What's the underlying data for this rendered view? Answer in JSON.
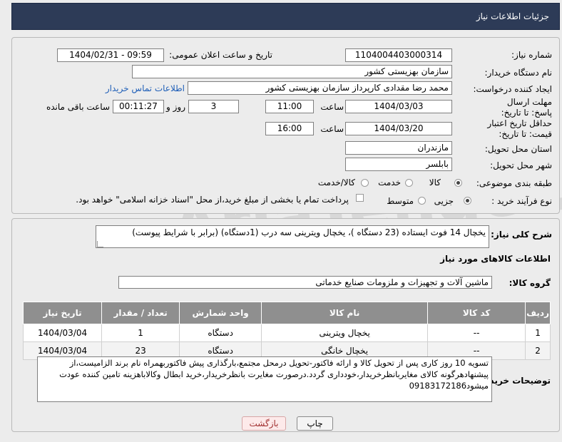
{
  "page_title": "جزئیات اطلاعات نیاز",
  "fields": {
    "need_number_label": "شماره نیاز:",
    "need_number": "1104004403000314",
    "announce_label": "تاریخ و ساعت اعلان عمومی:",
    "announce_value": "1404/02/31 - 09:59",
    "buyer_org_label": "نام دستگاه خریدار:",
    "buyer_org": "سازمان بهزیستی کشور",
    "creator_label": "ایجاد کننده درخواست:",
    "creator": "محمد رضا  مقدادی کارپرداز سازمان بهزیستی کشور",
    "contact_link": "اطلاعات تماس خریدار",
    "deadline_label": "مهلت ارسال پاسخ: تا تاریخ:",
    "deadline_date": "1404/03/03",
    "time_label": "ساعت",
    "deadline_time": "11:00",
    "days_value": "3",
    "days_label": "روز و",
    "remaining_time": "00:11:27",
    "remaining_label": "ساعت باقی مانده",
    "validity_label": "حداقل تاریخ اعتبار قیمت: تا تاریخ:",
    "validity_date": "1404/03/20",
    "validity_time": "16:00",
    "province_label": "استان محل تحویل:",
    "province": "مازندران",
    "city_label": "شهر محل تحویل:",
    "city": "بابلسر",
    "category_label": "طبقه بندی موضوعی:",
    "category_options": [
      "کالا",
      "خدمت",
      "کالا/خدمت"
    ],
    "category_selected": "کالا",
    "process_label": "نوع فرآیند خرید :",
    "process_options": [
      "جزیی",
      "متوسط"
    ],
    "process_selected": "جزیی",
    "payment_note": "پرداخت تمام یا بخشی از مبلغ خرید،از محل \"اسناد خزانه اسلامی\" خواهد بود."
  },
  "description": {
    "label": "شرح کلی نیاز:",
    "text": "یخچال 14 فوت ایستاده (23 دستگاه )، یخچال ویترینی سه درب (1دستگاه) (برابر با شرایط پیوست)"
  },
  "goods": {
    "section_title": "اطلاعات کالاهای مورد نیاز",
    "group_label": "گروه کالا:",
    "group_value": "ماشین آلات و تجهیزات و ملزومات صنایع خدماتی",
    "columns": [
      "ردیف",
      "کد کالا",
      "نام کالا",
      "واحد شمارش",
      "تعداد / مقدار",
      "تاریخ نیاز"
    ],
    "rows": [
      {
        "row": "1",
        "code": "--",
        "name": "یخچال ویترینی",
        "unit": "دستگاه",
        "qty": "1",
        "date": "1404/03/04"
      },
      {
        "row": "2",
        "code": "--",
        "name": "یخچال خانگی",
        "unit": "دستگاه",
        "qty": "23",
        "date": "1404/03/04"
      }
    ]
  },
  "buyer_notes": {
    "label": "توضیحات خریدار:",
    "text": "تسویه 10 روز کاری پس از تحویل کالا و ارائه فاکتور-تحویل درمحل مجتمع،بارگذاری پیش فاکتوربهمراه نام برند الزامیست،از پیشنهادهرگونه کالای مغایربانظرخریدار،خودداری گردد.درصورت مغایرت بانظرخریدار،خرید ابطال وکالاباهزینه تامین کننده عودت میشود09183172186"
  },
  "buttons": {
    "print": "چاپ",
    "back": "بازگشت"
  },
  "watermark": "AriaTender.neT",
  "colors": {
    "header_bg": "#2d3b57",
    "table_header_bg": "#8f8f8f",
    "link": "#1f5fb8"
  }
}
